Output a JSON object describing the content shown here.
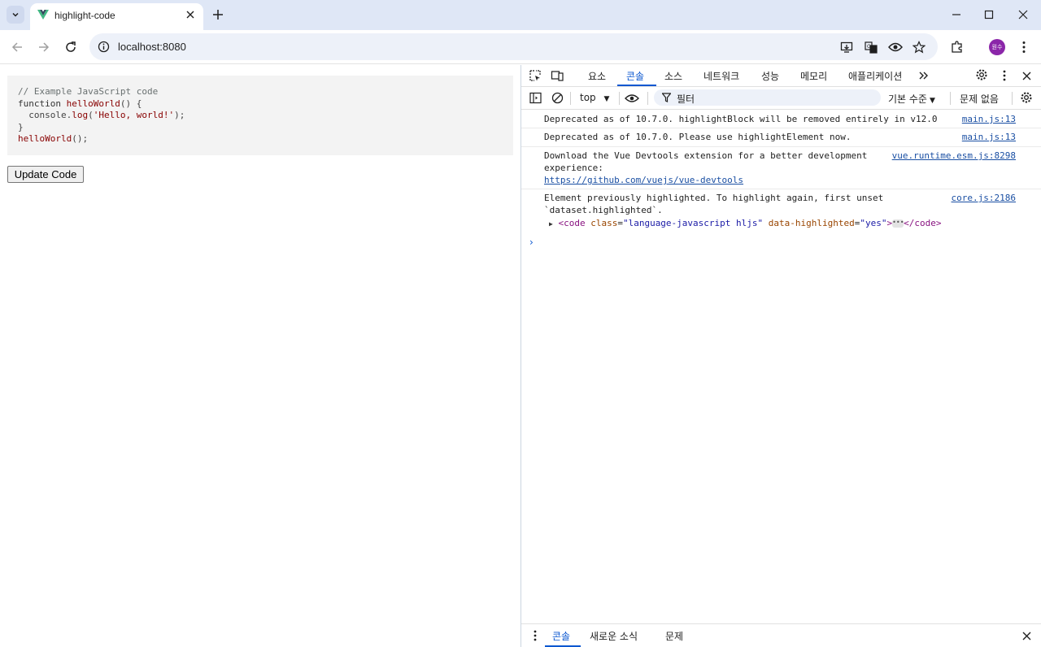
{
  "browser": {
    "tab_title": "highlight-code",
    "url": "localhost:8080",
    "profile_initials": "원수"
  },
  "page": {
    "code_lines": {
      "l1": "// Example JavaScript code",
      "l2_kw": "function",
      "l2_name": "helloWorld",
      "l2_rest": "() {",
      "l3_indent": "  console.",
      "l3_fn": "log",
      "l3_open": "(",
      "l3_str": "'Hello, world!'",
      "l3_close": ");",
      "l4": "}",
      "l5_name": "helloWorld",
      "l5_rest": "();"
    },
    "update_button": "Update Code"
  },
  "devtools": {
    "tabs": [
      "요소",
      "콘솔",
      "소스",
      "네트워크",
      "성능",
      "메모리",
      "애플리케이션"
    ],
    "active_tab": "콘솔",
    "context": "top",
    "filter_placeholder": "필터",
    "level": "기본 수준",
    "issues": "문제 없음",
    "messages": [
      {
        "text": "Deprecated as of 10.7.0. highlightBlock will be removed entirely in v12.0",
        "source": "main.js:13"
      },
      {
        "text": "Deprecated as of 10.7.0. Please use highlightElement now.",
        "source": "main.js:13"
      },
      {
        "text_line1": "Download the Vue Devtools extension for a better development",
        "text_line2": "experience:",
        "link": "https://github.com/vuejs/vue-devtools",
        "source": "vue.runtime.esm.js:8298"
      },
      {
        "text_line1": "Element previously highlighted. To highlight again, first unset",
        "text_line2": "`dataset.highlighted`.",
        "source": "core.js:2186",
        "element": {
          "open_tag": "<code",
          "attr1": "class",
          "val1": "\"language-javascript hljs\"",
          "attr2": "data-highlighted",
          "val2": "\"yes\"",
          "close": ">",
          "end_tag": "</code>"
        }
      }
    ],
    "prompt": "›",
    "drawer_tabs": [
      "콘솔",
      "새로운 소식",
      "문제"
    ]
  },
  "colors": {
    "accent": "#0b57d0",
    "link": "#1a4fa3",
    "code_bg": "#f3f3f3"
  }
}
